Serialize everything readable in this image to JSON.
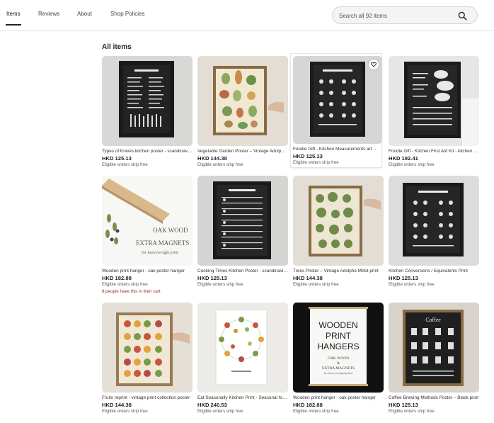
{
  "nav": {
    "tabs": [
      {
        "label": "Items",
        "active": true
      },
      {
        "label": "Reviews",
        "active": false
      },
      {
        "label": "About",
        "active": false
      },
      {
        "label": "Shop Policies",
        "active": false
      }
    ]
  },
  "search": {
    "placeholder": "Search all 92 items"
  },
  "section": {
    "title": "All items"
  },
  "colors": {
    "accent_text": "#222222",
    "note_red": "#9b2c2c"
  },
  "items": [
    {
      "title": "Types of Knives kitchen poster - scandinavian print",
      "price": "HKD 125.13",
      "shipping": "Eligible orders ship free"
    },
    {
      "title": "Vegetable Garden Poster – Vintage Adolphe Millot print",
      "price": "HKD 144.38",
      "shipping": "Eligible orders ship free"
    },
    {
      "title": "Foodie Gift - Kitchen Measurements art print",
      "price": "HKD 125.13",
      "shipping": "Eligible orders ship free"
    },
    {
      "title": "Foodie Gift - Kitchen First Aid Kit - kitchen print",
      "price": "HKD 192.41",
      "shipping": "Eligible orders ship free"
    },
    {
      "title": "Wooden print hanger - oak poster hanger",
      "price": "HKD 182.88",
      "shipping": "Eligible orders ship free",
      "note": "8 people have this in their cart"
    },
    {
      "title": "Cooking Times Kitchen Poster - scandinavian print",
      "price": "HKD 125.13",
      "shipping": "Eligible orders ship free"
    },
    {
      "title": "Trees Poster – Vintage Adolphe Millot print",
      "price": "HKD 144.38",
      "shipping": "Eligible orders ship free"
    },
    {
      "title": "Kitchen Conversions / Equivalents Print",
      "price": "HKD 125.13",
      "shipping": "Eligible orders ship free"
    },
    {
      "title": "Fruits reprint - vintage print collection poster",
      "price": "HKD 144.38",
      "shipping": "Eligible orders ship free"
    },
    {
      "title": "Eat Seasonally Kitchen Print - Seasonal food poster",
      "price": "HKD 240.53",
      "shipping": "Eligible orders ship free"
    },
    {
      "title": "Wooden print hanger - oak poster hanger",
      "price": "HKD 182.88",
      "shipping": "Eligible orders ship free"
    },
    {
      "title": "Coffee Brewing Methods Poster – Black print",
      "price": "HKD 125.13",
      "shipping": "Eligible orders ship free"
    }
  ],
  "artwork": {
    "hanger_lines": [
      "OAK WOOD",
      "EXTRA MAGNETS",
      "for heavyweight print"
    ],
    "wooden_poster": {
      "heading": [
        "WOODEN",
        "PRINT",
        "HANGERS"
      ],
      "lines": [
        "OAK WOOD",
        "&",
        "EXTRA MAGNETS",
        "for heavyweight prints"
      ]
    },
    "coffee_title": "Coffee"
  }
}
